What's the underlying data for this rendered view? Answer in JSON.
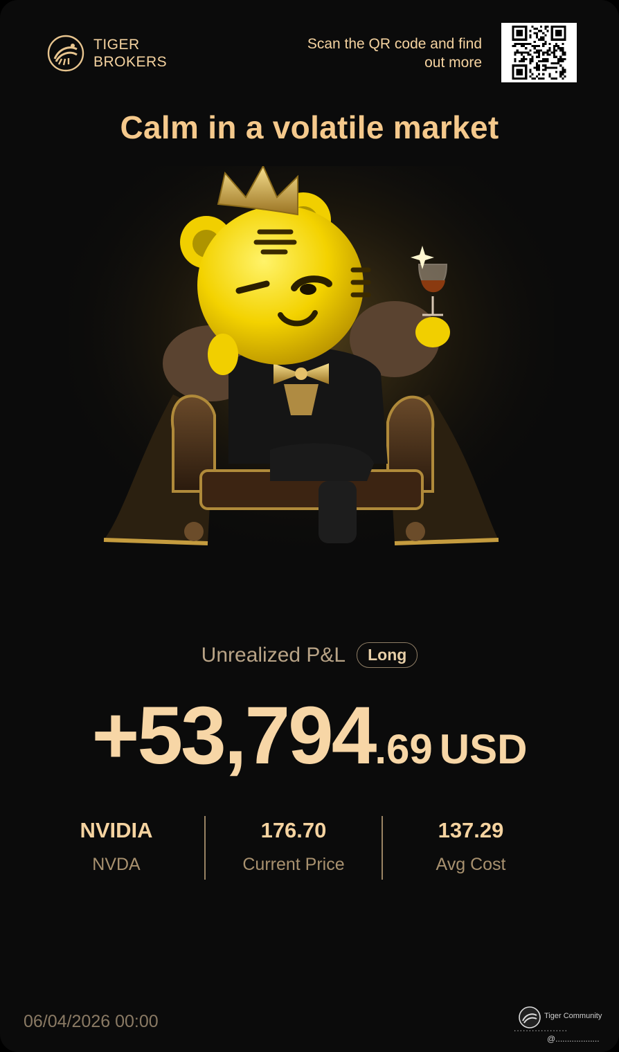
{
  "brand": {
    "line1": "TIGER",
    "line2": "BROKERS"
  },
  "qr_prompt": {
    "line1": "Scan the QR code and find",
    "line2": "out more"
  },
  "headline": "Calm in a volatile market",
  "pl": {
    "label": "Unrealized P&L",
    "tag": "Long",
    "amount_main": "+53,794",
    "amount_decimal": ".69",
    "currency": "USD"
  },
  "stats": [
    {
      "value": "NVIDIA",
      "label": "NVDA"
    },
    {
      "value": "176.70",
      "label": "Current Price"
    },
    {
      "value": "137.29",
      "label": "Avg Cost"
    }
  ],
  "footer": {
    "date": "06/04/2026 00:00",
    "community_name": "Tiger Community",
    "dots": "..................",
    "handle": "@..................."
  },
  "colors": {
    "accent": "#f5d3a0",
    "background": "#0b0b0b",
    "tiger": "#f5d800",
    "throne": "#4a2c17"
  }
}
